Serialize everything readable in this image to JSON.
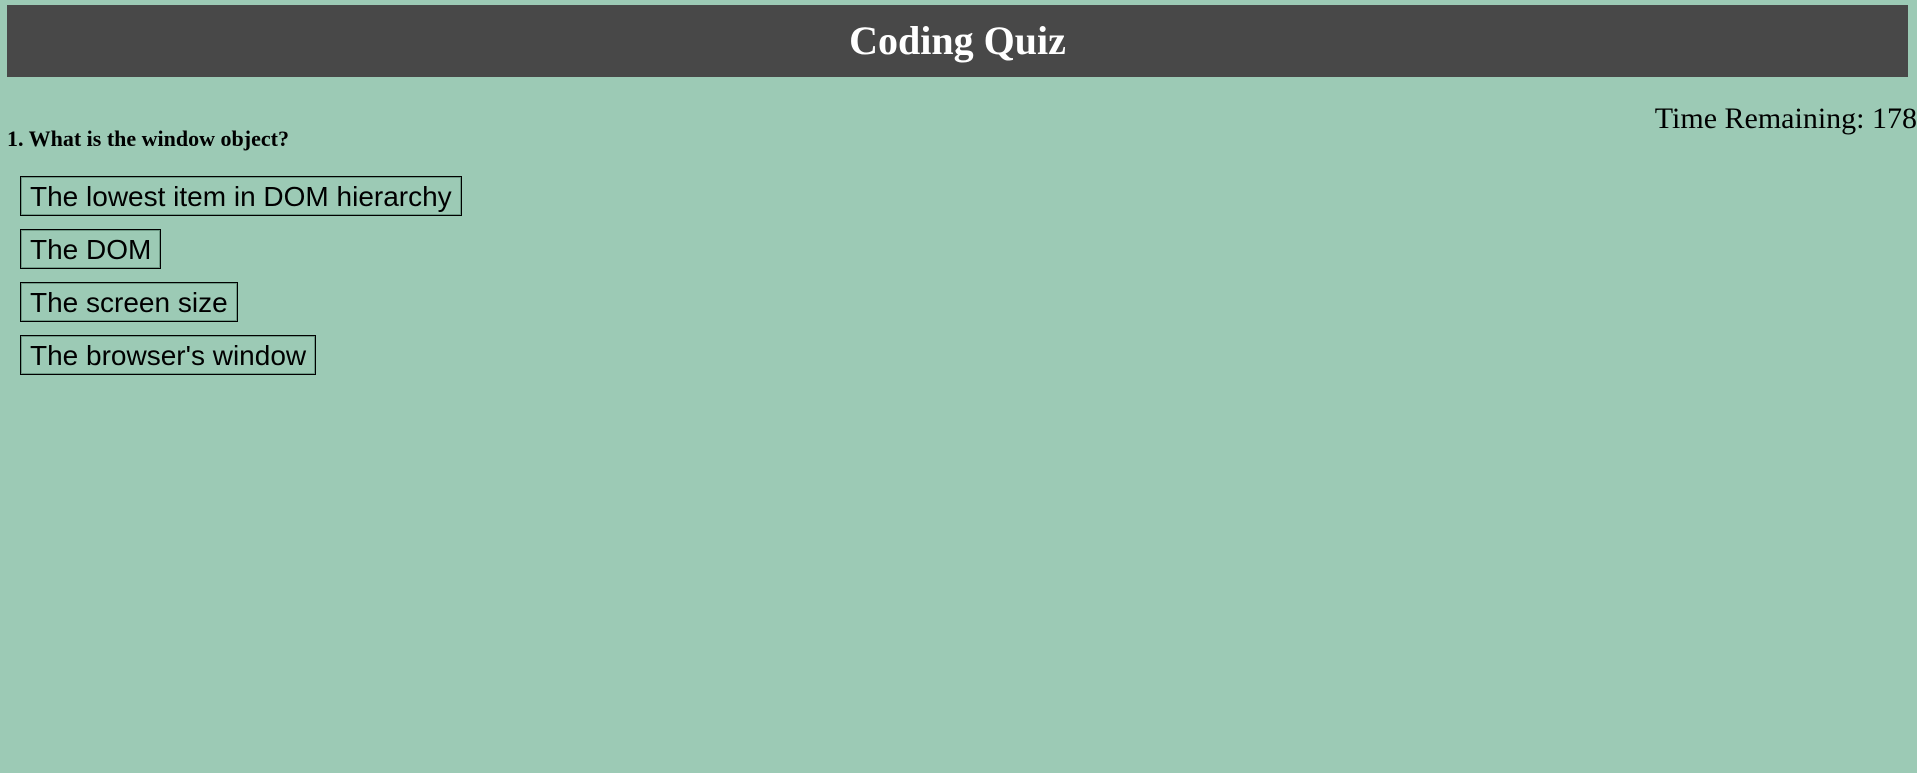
{
  "header": {
    "title": "Coding Quiz"
  },
  "timer": {
    "text": "Time Remaining: 178"
  },
  "question": {
    "text": "1. What is the window object?"
  },
  "answers": [
    {
      "label": "The lowest item in DOM hierarchy"
    },
    {
      "label": "The DOM"
    },
    {
      "label": "The screen size"
    },
    {
      "label": "The browser's window"
    }
  ],
  "colors": {
    "background": "#9ccab5",
    "header_background": "#484848",
    "header_text": "#ffffff"
  }
}
